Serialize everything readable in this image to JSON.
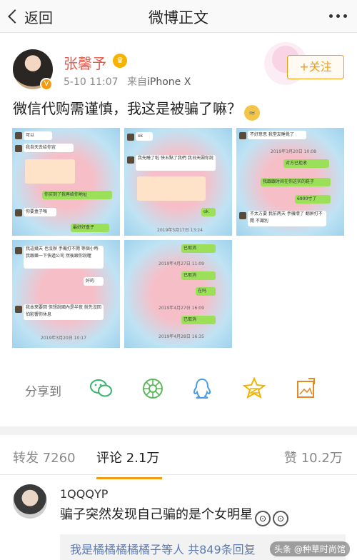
{
  "header": {
    "back_label": "返回",
    "title": "微博正文"
  },
  "post": {
    "author": "张馨予",
    "time": "5-10 11:07",
    "source_prefix": "来自",
    "source": "iPhone X",
    "follow_label": "+关注",
    "text": "微信代购需谨慎，我这是被骗了嘛？",
    "images": [
      {
        "lines": [
          "可以",
          "我自天去给你宜",
          "你买到了我再给你地址",
          "你要盒子嗎",
          "最好好盒子"
        ]
      },
      {
        "lines": [
          "ok",
          "我先睡了啦 快五點了我們 我日天圍你說",
          "ok",
          "2019年3月17日 13:24"
        ]
      },
      {
        "lines": [
          "不好意思 我堂友睡覺了",
          "2019年3月20日 10:08",
          "对方已拒收",
          "我跟跟时间在你这实的鞋子",
          "6900寸了",
          "不太方要 我前两天 手機壞了 翻屏打不開 不識別"
        ]
      },
      {
        "lines": [
          "我這幾天 也沒辦 手機打不開 等個小時 我跟樂一下快遞公司 然後跟你說喔",
          "好的",
          "我本來要回 但想說國內是半夜 就先沒回 怕影響你休息",
          "2019年3月20日 10:17"
        ]
      },
      {
        "lines": [
          "已取消",
          "2019年4月27日 11:09",
          "已取消",
          "在吗",
          "2019年4月27日 16:09",
          "已取消",
          "2019年4月28日 16:35"
        ]
      }
    ]
  },
  "share": {
    "label": "分享到",
    "icons": [
      "wechat-icon",
      "moments-icon",
      "qq-icon",
      "qzone-icon",
      "save-image-icon"
    ]
  },
  "tabs": [
    {
      "label": "转发",
      "count": "7260"
    },
    {
      "label": "评论",
      "count": "2.1万"
    },
    {
      "label": "赞",
      "count": "10.2万"
    }
  ],
  "comment": {
    "user": "1QQQYP",
    "text": "骗子突然发现自己骗的是个女明星",
    "reply_summary": "我是橘橘橘橘橘子等人  共849条回复",
    "watermark": "头条 @种草时尚馆"
  },
  "colors": {
    "accent": "#f39c12",
    "username": "#e8584a",
    "link": "#5a7bb4"
  }
}
